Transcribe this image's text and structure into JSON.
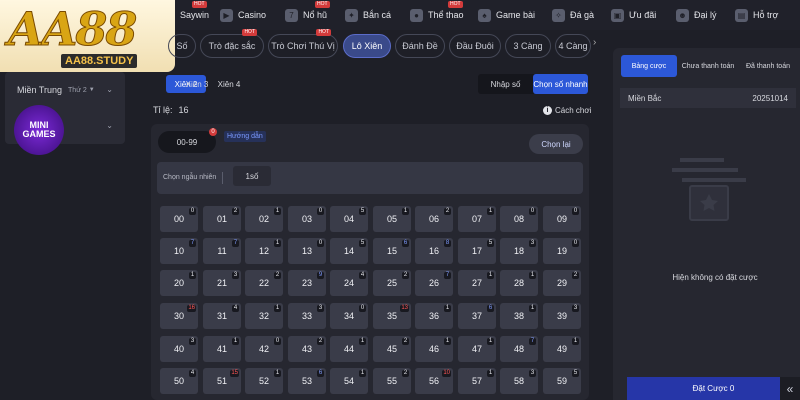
{
  "nav": {
    "items": [
      {
        "label": "Saywin",
        "icon": "slot-icon",
        "hot": true
      },
      {
        "label": "Casino",
        "icon": "casino-icon",
        "hot": false
      },
      {
        "label": "Nổ hũ",
        "icon": "jackpot-icon",
        "hot": true
      },
      {
        "label": "Bắn cá",
        "icon": "fish-icon",
        "hot": false
      },
      {
        "label": "Thể thao",
        "icon": "sports-icon",
        "hot": true
      },
      {
        "label": "Game bài",
        "icon": "cards-icon",
        "hot": false
      },
      {
        "label": "Đá gà",
        "icon": "cockfight-icon",
        "hot": false
      },
      {
        "label": "Ưu đãi",
        "icon": "promo-icon",
        "hot": false
      },
      {
        "label": "Đại lý",
        "icon": "agent-icon",
        "hot": false
      },
      {
        "label": "Hỗ trợ",
        "icon": "support-icon",
        "hot": false
      }
    ],
    "hot_label": "HOT"
  },
  "logo": {
    "big": "AA88",
    "sub": "AA88.STUDY"
  },
  "sidebar": {
    "region": "Miền Trung",
    "day": "Thứ 2",
    "mini_games": "MINI GAMES"
  },
  "tabs": [
    {
      "label": "Số",
      "active": false,
      "hot": false
    },
    {
      "label": "Trò đặc sắc",
      "active": false,
      "hot": true
    },
    {
      "label": "Trò Chơi Thú Vị",
      "active": false,
      "hot": true
    },
    {
      "label": "Lô Xiên",
      "active": true,
      "hot": false
    },
    {
      "label": "Đánh Đề",
      "active": false,
      "hot": false
    },
    {
      "label": "Đầu Đuôi",
      "active": false,
      "hot": false
    },
    {
      "label": "3 Càng",
      "active": false,
      "hot": false
    },
    {
      "label": "4 Càng",
      "active": false,
      "hot": false
    }
  ],
  "subtabs": [
    {
      "label": "Xiên 2",
      "active": true
    },
    {
      "label": "Xiên 3",
      "active": false
    },
    {
      "label": "Xiên 4",
      "active": false
    }
  ],
  "mode": {
    "manual": "Nhập số",
    "quick": "Chọn số nhanh"
  },
  "rate": {
    "label": "Tỉ lệ:",
    "value": "16"
  },
  "help": "Cách chơi",
  "board": {
    "range": "00-99",
    "range_badge": "0",
    "guide": "Hướng dẫn",
    "reset": "Chọn lại",
    "random_label": "Chọn ngẫu nhiên",
    "random_option": "1số",
    "cells": [
      {
        "n": "00",
        "c": "0",
        "t": ""
      },
      {
        "n": "01",
        "c": "2",
        "t": ""
      },
      {
        "n": "02",
        "c": "1",
        "t": ""
      },
      {
        "n": "03",
        "c": "0",
        "t": ""
      },
      {
        "n": "04",
        "c": "5",
        "t": ""
      },
      {
        "n": "05",
        "c": "1",
        "t": ""
      },
      {
        "n": "06",
        "c": "2",
        "t": ""
      },
      {
        "n": "07",
        "c": "1",
        "t": ""
      },
      {
        "n": "08",
        "c": "0",
        "t": ""
      },
      {
        "n": "09",
        "c": "0",
        "t": ""
      },
      {
        "n": "10",
        "c": "7",
        "t": "blue"
      },
      {
        "n": "11",
        "c": "7",
        "t": "blue"
      },
      {
        "n": "12",
        "c": "1",
        "t": ""
      },
      {
        "n": "13",
        "c": "0",
        "t": ""
      },
      {
        "n": "14",
        "c": "5",
        "t": ""
      },
      {
        "n": "15",
        "c": "6",
        "t": "blue"
      },
      {
        "n": "16",
        "c": "8",
        "t": "blue"
      },
      {
        "n": "17",
        "c": "5",
        "t": ""
      },
      {
        "n": "18",
        "c": "3",
        "t": ""
      },
      {
        "n": "19",
        "c": "0",
        "t": ""
      },
      {
        "n": "20",
        "c": "1",
        "t": ""
      },
      {
        "n": "21",
        "c": "3",
        "t": ""
      },
      {
        "n": "22",
        "c": "2",
        "t": ""
      },
      {
        "n": "23",
        "c": "9",
        "t": "blue"
      },
      {
        "n": "24",
        "c": "4",
        "t": ""
      },
      {
        "n": "25",
        "c": "2",
        "t": ""
      },
      {
        "n": "26",
        "c": "7",
        "t": "blue"
      },
      {
        "n": "27",
        "c": "1",
        "t": ""
      },
      {
        "n": "28",
        "c": "1",
        "t": ""
      },
      {
        "n": "29",
        "c": "2",
        "t": ""
      },
      {
        "n": "30",
        "c": "16",
        "t": "red"
      },
      {
        "n": "31",
        "c": "4",
        "t": ""
      },
      {
        "n": "32",
        "c": "1",
        "t": ""
      },
      {
        "n": "33",
        "c": "3",
        "t": ""
      },
      {
        "n": "34",
        "c": "0",
        "t": ""
      },
      {
        "n": "35",
        "c": "13",
        "t": "red"
      },
      {
        "n": "36",
        "c": "1",
        "t": ""
      },
      {
        "n": "37",
        "c": "6",
        "t": "blue"
      },
      {
        "n": "38",
        "c": "1",
        "t": ""
      },
      {
        "n": "39",
        "c": "3",
        "t": ""
      },
      {
        "n": "40",
        "c": "3",
        "t": ""
      },
      {
        "n": "41",
        "c": "1",
        "t": ""
      },
      {
        "n": "42",
        "c": "0",
        "t": ""
      },
      {
        "n": "43",
        "c": "2",
        "t": ""
      },
      {
        "n": "44",
        "c": "1",
        "t": ""
      },
      {
        "n": "45",
        "c": "2",
        "t": ""
      },
      {
        "n": "46",
        "c": "1",
        "t": ""
      },
      {
        "n": "47",
        "c": "1",
        "t": ""
      },
      {
        "n": "48",
        "c": "7",
        "t": "blue"
      },
      {
        "n": "49",
        "c": "1",
        "t": ""
      },
      {
        "n": "50",
        "c": "4",
        "t": ""
      },
      {
        "n": "51",
        "c": "15",
        "t": "red"
      },
      {
        "n": "52",
        "c": "1",
        "t": ""
      },
      {
        "n": "53",
        "c": "6",
        "t": "blue"
      },
      {
        "n": "54",
        "c": "1",
        "t": ""
      },
      {
        "n": "55",
        "c": "2",
        "t": ""
      },
      {
        "n": "56",
        "c": "10",
        "t": "red"
      },
      {
        "n": "57",
        "c": "1",
        "t": ""
      },
      {
        "n": "58",
        "c": "3",
        "t": ""
      },
      {
        "n": "59",
        "c": "5",
        "t": ""
      }
    ]
  },
  "right": {
    "tabs": [
      {
        "label": "Bảng cược",
        "active": true
      },
      {
        "label": "Chưa thanh toán",
        "active": false
      },
      {
        "label": "Đã thanh toán",
        "active": false
      }
    ],
    "region": "Miền Bắc",
    "date": "20251014",
    "empty": "Hiện không có đặt cược",
    "bet_button": "Đặt Cược 0"
  },
  "colors": {
    "accent": "#2c58d8",
    "active_tab": "#3a4a8a",
    "hot": "#d33b3b",
    "count_red": "#ff5656",
    "count_blue": "#7f9bff"
  }
}
